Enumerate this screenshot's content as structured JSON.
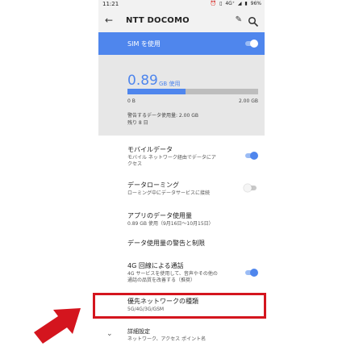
{
  "status_bar": {
    "time": "11:21",
    "battery": "96%",
    "network": "4G⁺"
  },
  "app_bar": {
    "title": "NTT DOCOMO",
    "back_icon": "arrow-back-icon",
    "edit_icon": "pencil-icon",
    "search_icon": "search-icon"
  },
  "sim": {
    "label": "SIM を使用",
    "enabled": true
  },
  "usage": {
    "amount": "0.89",
    "unit": "GB 使用",
    "used_fraction": 0.445,
    "min_label": "0 B",
    "max_label": "2.00 GB",
    "warning": "警告するデータ使用量: 2.00 GB",
    "remaining": "残り 8 日"
  },
  "settings": [
    {
      "title": "モバイルデータ",
      "subtitle_lines": [
        "モバイル ネットワーク経由でデータにア",
        "クセス"
      ],
      "toggle": "on"
    },
    {
      "title": "データローミング",
      "subtitle_lines": [
        "ローミング中にデータサービスに接続"
      ],
      "toggle": "off"
    },
    {
      "title": "アプリのデータ使用量",
      "subtitle_lines": [
        "0.89 GB 使用（9月16日～10月15日）"
      ]
    },
    {
      "title": "データ使用量の警告と制限",
      "subtitle_lines": []
    },
    {
      "title": "4G 回線による通話",
      "subtitle_lines": [
        "4G サービスを使用して、音声やその他の",
        "通話の品質を改善する（推奨）"
      ],
      "toggle": "on"
    },
    {
      "title": "優先ネットワークの種類",
      "subtitle_lines": [
        "5G/4G/3G/GSM"
      ]
    },
    {
      "title": "詳細設定",
      "subtitle_lines": [
        "ネットワーク、アクセス ポイント名"
      ]
    }
  ],
  "colors": {
    "accent": "#4f86ed",
    "highlight": "#d4151e"
  }
}
